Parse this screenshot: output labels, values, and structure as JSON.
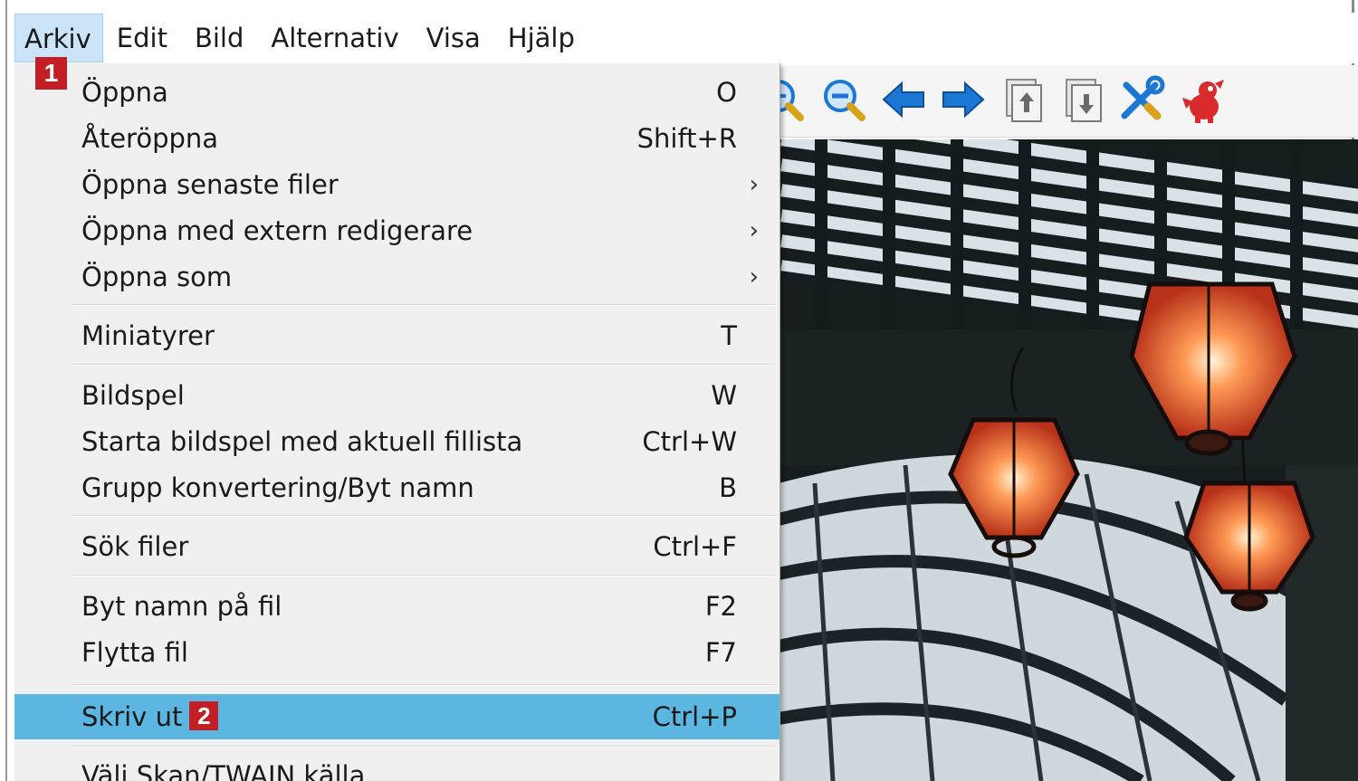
{
  "menubar": {
    "items": [
      {
        "label": "Arkiv"
      },
      {
        "label": "Edit"
      },
      {
        "label": "Bild"
      },
      {
        "label": "Alternativ"
      },
      {
        "label": "Visa"
      },
      {
        "label": "Hjälp"
      }
    ]
  },
  "callouts": {
    "one": "1",
    "two": "2"
  },
  "toolbar": {
    "icons": [
      "zoom-in-icon",
      "zoom-out-icon",
      "arrow-left-icon",
      "arrow-right-icon",
      "page-up-icon",
      "page-down-icon",
      "tools-icon",
      "mascot-icon"
    ],
    "accent_blue": "#1a78d4",
    "accent_red": "#d92b2b"
  },
  "menu": {
    "highlight_color": "#5bb7e1",
    "items": [
      {
        "label": "Öppna",
        "shortcut": "O"
      },
      {
        "label": "Återöppna",
        "shortcut": "Shift+R"
      },
      {
        "label": "Öppna senaste filer",
        "submenu": "›"
      },
      {
        "label": "Öppna med extern redigerare",
        "submenu": "›"
      },
      {
        "label": "Öppna som",
        "submenu": "›"
      },
      {
        "label": "Miniatyrer",
        "shortcut": "T"
      },
      {
        "label": "Bildspel",
        "shortcut": "W"
      },
      {
        "label": "Starta bildspel med aktuell fillista",
        "shortcut": "Ctrl+W"
      },
      {
        "label": "Grupp konvertering/Byt namn",
        "shortcut": "B"
      },
      {
        "label": "Sök filer",
        "shortcut": "Ctrl+F"
      },
      {
        "label": "Byt namn på fil",
        "shortcut": "F2"
      },
      {
        "label": "Flytta fil",
        "shortcut": "F7"
      },
      {
        "label": "Skriv ut",
        "shortcut": "Ctrl+P"
      },
      {
        "label": "Välj Skan/TWAIN källa"
      }
    ]
  }
}
